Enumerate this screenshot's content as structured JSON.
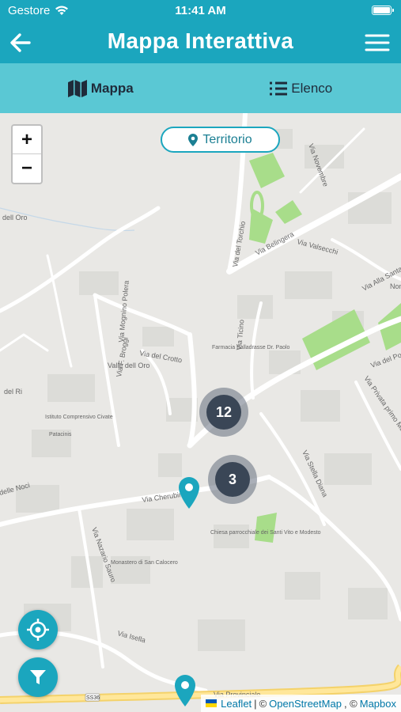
{
  "status_bar": {
    "carrier": "Gestore",
    "time": "11:41 AM"
  },
  "header": {
    "title": "Mappa Interattiva",
    "back_icon": "arrow-left-icon",
    "menu_icon": "hamburger-menu-icon"
  },
  "tabs": [
    {
      "label": "Mappa",
      "icon": "map-icon",
      "active": true
    },
    {
      "label": "Elenco",
      "icon": "list-icon",
      "active": false
    }
  ],
  "map": {
    "zoom_in": "+",
    "zoom_out": "−",
    "territory_button": "Territorio",
    "clusters": [
      {
        "count": "12"
      },
      {
        "count": "3"
      }
    ],
    "street_labels": [
      "Via Novembre",
      "Via del Torchio",
      "Via Belingera",
      "Via Valsecchi",
      "Via Alla Santa",
      "Non",
      "Via del Ponte",
      "Via Privata primo Maggio",
      "Via Stella Diana",
      "Via Isella",
      "Via Provinciale",
      "Via Cherubino",
      "Via Nazario Sauro",
      "Via del Crotto",
      "Via F. Broggi",
      "Via Mognino Polera",
      "Via Ticino",
      "delle Noci",
      "del Ri",
      "dell Oro",
      "Valle dell Oro",
      "Via F. Broggi"
    ],
    "poi_labels": [
      "Farmacia Balladrasse Dr. Paolo",
      "Istituto Comprensivo Civate",
      "Patacinis",
      "Monastero di San Calocero",
      "Chiesa parrocchiale dei Santi Vito e Modesto",
      "SS36"
    ],
    "attribution": {
      "leaflet": "Leaflet",
      "osm": "OpenStreetMap",
      "mapbox": "Mapbox",
      "sep": "|",
      "copy1": "©",
      "copy2": ", ©"
    }
  },
  "colors": {
    "primary": "#1ba6be",
    "tab_bar": "#5ac8d4",
    "cluster": "#3a4656",
    "park": "#a8dd8a"
  }
}
